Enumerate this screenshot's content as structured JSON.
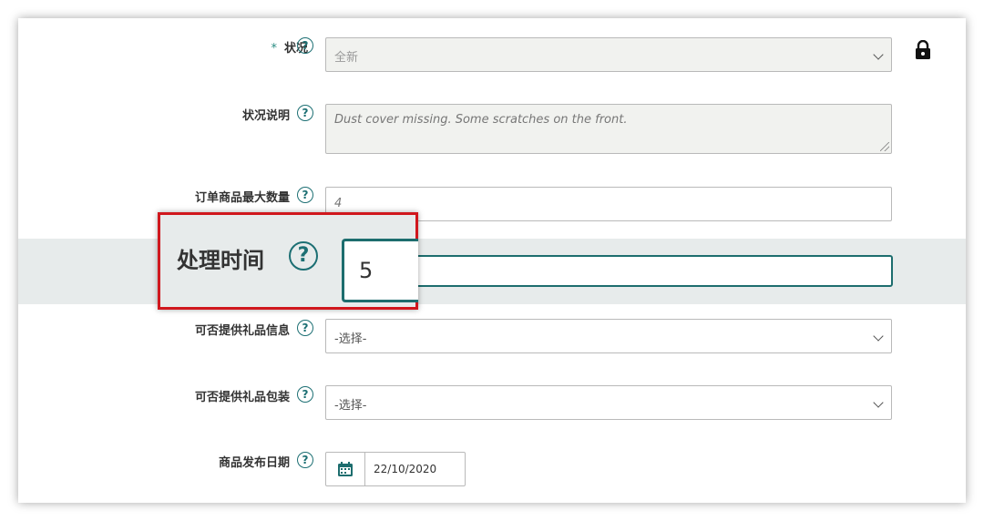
{
  "form": {
    "condition": {
      "required_mark": "*",
      "label": "状况",
      "value": "全新"
    },
    "condition_note": {
      "label": "状况说明",
      "value": "Dust cover missing. Some scratches on the front."
    },
    "max_order_qty": {
      "label": "订单商品最大数量",
      "value": "4"
    },
    "handling_time": {
      "label": "处理时间",
      "value": "5"
    },
    "gift_message": {
      "label": "可否提供礼品信息",
      "value": "-选择-"
    },
    "gift_wrap": {
      "label": "可否提供礼品包装",
      "value": "-选择-"
    },
    "release_date": {
      "label": "商品发布日期",
      "value": "22/10/2020"
    }
  },
  "icons": {
    "help": "?",
    "lock": "lock-icon",
    "calendar": "calendar-icon"
  },
  "colors": {
    "accent": "#1d6d6e",
    "highlight_border": "#d0171d",
    "band": "#e7ebeb"
  }
}
